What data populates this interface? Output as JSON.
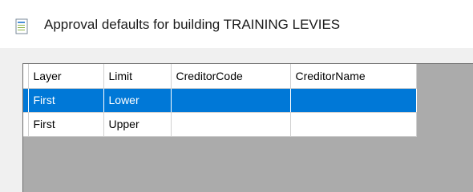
{
  "window": {
    "title": "Approval defaults for building TRAINING LEVIES",
    "icon": "document-icon"
  },
  "grid": {
    "columns": [
      "Layer",
      "Limit",
      "CreditorCode",
      "CreditorName"
    ],
    "rows": [
      {
        "layer": "First",
        "limit": "Lower",
        "creditor_code": "",
        "creditor_name": "",
        "selected": true
      },
      {
        "layer": "First",
        "limit": "Upper",
        "creditor_code": "",
        "creditor_name": "",
        "selected": false
      }
    ],
    "colors": {
      "selection": "#0078d7",
      "empty_area": "#ababab"
    }
  }
}
